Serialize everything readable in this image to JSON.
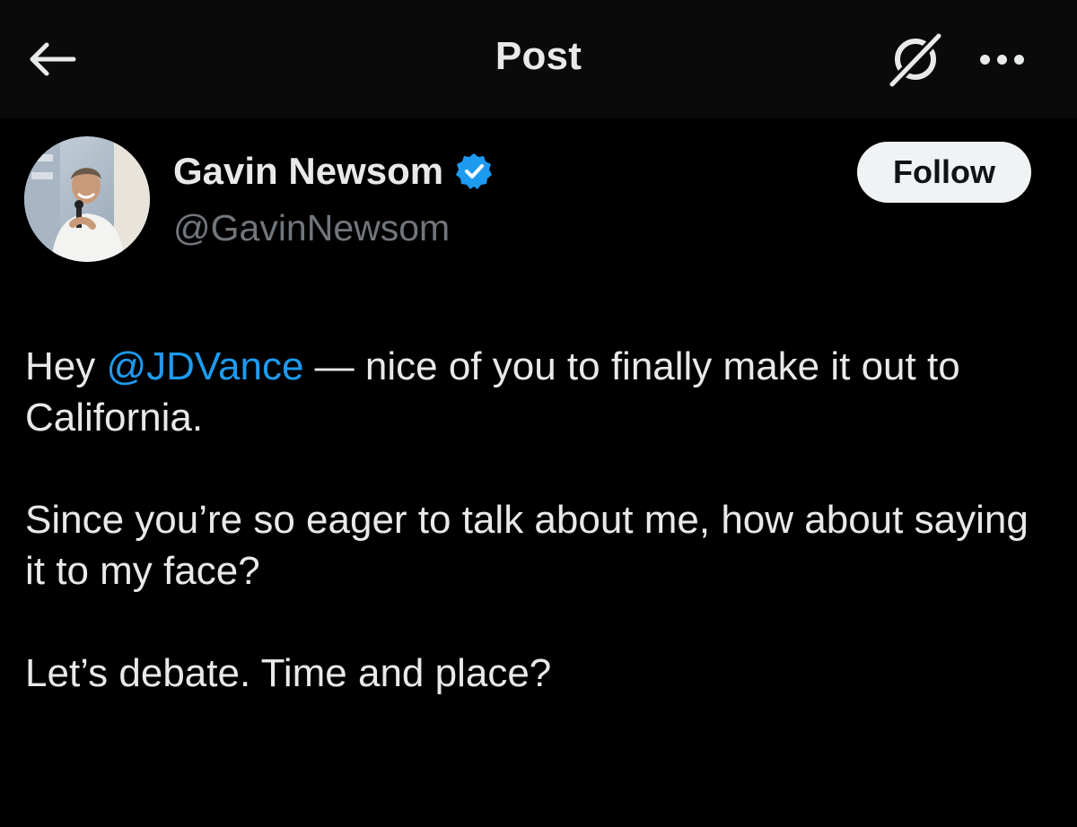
{
  "header": {
    "title": "Post",
    "back_icon": "arrow-left-icon",
    "grok_icon": "grok-icon",
    "more_icon": "more-horizontal-icon"
  },
  "author": {
    "display_name": "Gavin Newsom",
    "handle": "@GavinNewsom",
    "verified_icon": "verified-badge-icon",
    "verified_color": "#1d9bf0",
    "avatar_icon": "profile-photo"
  },
  "follow_button": {
    "label": "Follow"
  },
  "post": {
    "line1_before": "Hey ",
    "mention": "@JDVance",
    "line1_after": " — nice of you to finally make it out to California.",
    "paragraph2": "Since you’re so eager to talk about me, how about saying it to my face?",
    "paragraph3": "Let’s debate. Time and place?"
  },
  "colors": {
    "background": "#000000",
    "header_background": "#0a0a0a",
    "text": "#e7e9ea",
    "secondary_text": "#71767b",
    "accent": "#1d9bf0",
    "button_background": "#eff3f4"
  }
}
